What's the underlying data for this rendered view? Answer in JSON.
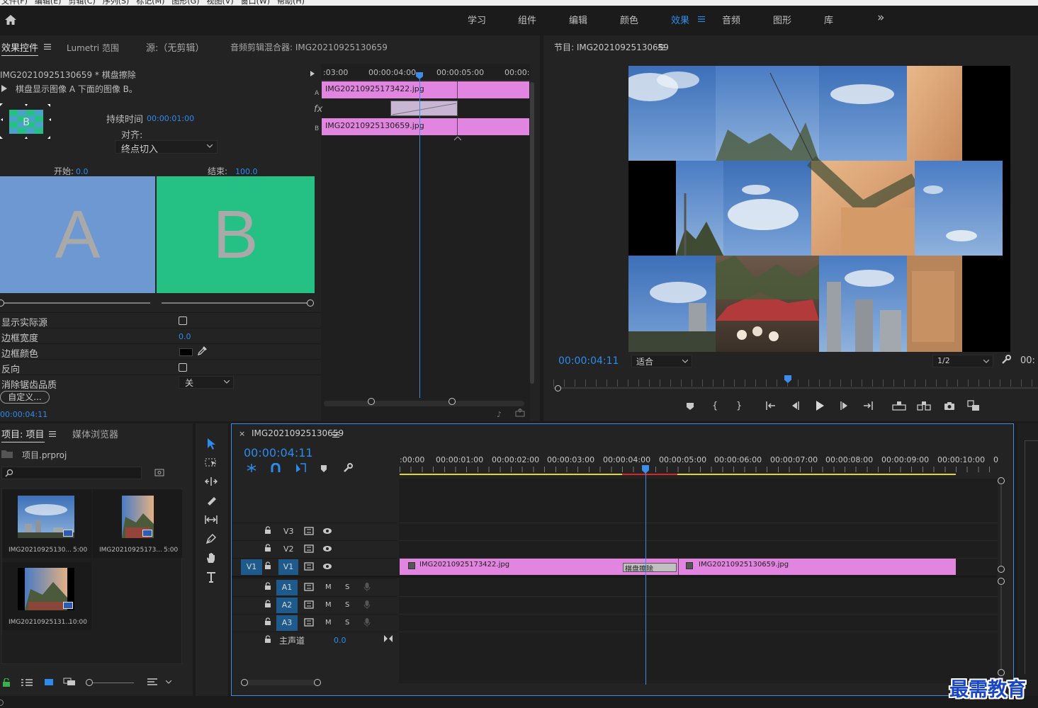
{
  "menubar": {
    "items": [
      "文件(F)",
      "编辑(E)",
      "剪辑(C)",
      "序列(S)",
      "标记(M)",
      "图形(G)",
      "视图(V)",
      "窗口(W)",
      "帮助(H)"
    ]
  },
  "workspaces": {
    "tabs": [
      "学习",
      "组件",
      "编辑",
      "颜色",
      "效果",
      "音频",
      "图形",
      "库"
    ],
    "active": "效果",
    "more": "»"
  },
  "source_panel": {
    "tabs": [
      "效果控件",
      "Lumetri 范围",
      "源:（无剪辑）",
      "音频剪辑混合器: IMG20210925130659"
    ],
    "active_tab": "效果控件",
    "clip_header": "IMG20210925130659 * 棋盘擦除",
    "description": "棋盘显示图像 A 下面的图像 B。",
    "duration_label": "持续时间",
    "duration_value": "00:00:01:00",
    "align_label": "对齐:",
    "align_value": "终点切入",
    "start_label": "开始:",
    "start_value": "0.0",
    "end_label": "结束:",
    "end_value": "100.0",
    "a_letter": "A",
    "b_letter": "B",
    "a_color": "#6d98d2",
    "b_color": "#25c083",
    "props": [
      {
        "label": "显示实际源"
      },
      {
        "label": "边框宽度",
        "value": "0.0"
      },
      {
        "label": "边框颜色"
      },
      {
        "label": "反向"
      },
      {
        "label": "消除锯齿品质",
        "value": "关"
      }
    ],
    "custom_button": "自定义...",
    "footer_time": "00:00:04:11",
    "mini_timeline": {
      "ruler": [
        ":03:00",
        "00:00:04:00",
        "00:00:05:00",
        "00:00:"
      ],
      "track_a_label": "A",
      "track_b_label": "B",
      "fx_label": "fx",
      "clip_a": "IMG20210925173422.jpg",
      "clip_b": "IMG20210925130659.jpg"
    }
  },
  "program_monitor": {
    "title": "节目: IMG20210925130659",
    "timecode": "00:00:04:11",
    "fit": "适合",
    "quality": "1/2",
    "right_time": "00:"
  },
  "project_panel": {
    "tabs": [
      "项目: 项目",
      "媒体浏览器"
    ],
    "file": "项目.prproj",
    "items": [
      {
        "name": "IMG20210925130...",
        "duration": "5:00"
      },
      {
        "name": "IMG20210925173...",
        "duration": "5:00"
      },
      {
        "name": "IMG20210925131...",
        "duration": "10:00"
      }
    ]
  },
  "timeline": {
    "sequence": "IMG20210925130659",
    "timecode": "00:00:04:11",
    "ruler": [
      ":00:00",
      "00:00:01:00",
      "00:00:02:00",
      "00:00:03:00",
      "00:00:04:00",
      "00:00:05:00",
      "00:00:06:00",
      "00:00:07:00",
      "00:00:08:00",
      "00:00:09:00",
      "00:00:10:00",
      "0"
    ],
    "tracks": [
      "V3",
      "V2",
      "V1",
      "A1",
      "A2",
      "A3"
    ],
    "source_patch": "V1",
    "m_label": "M",
    "s_label": "S",
    "master": "主声道",
    "master_value": "0.0",
    "clip1": "IMG20210925173422.jpg",
    "clip2": "IMG20210925130659.jpg",
    "transition": "棋盘擦除",
    "clip_color": "#e285e0"
  },
  "watermark": "最需教育"
}
